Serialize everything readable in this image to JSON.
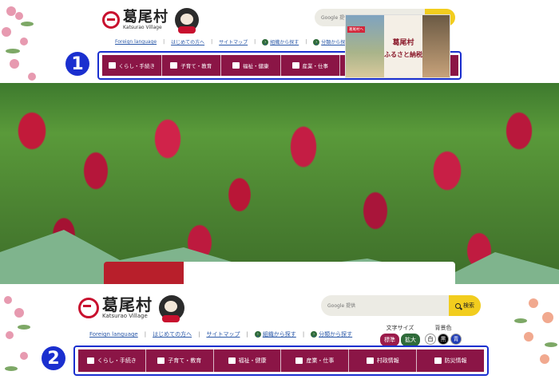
{
  "site": {
    "logo_text": "葛尾村",
    "logo_subtext": "Katsurao Village"
  },
  "search": {
    "placeholder": "Google 提供",
    "button_label": "検索"
  },
  "utility_links": {
    "foreign_language": "Foreign language",
    "first_time": "はじめての方へ",
    "sitemap": "サイトマップ",
    "by_organization": "組織から探す",
    "by_category": "分類から探す"
  },
  "text_size": {
    "label": "文字サイズ",
    "standard": "標準",
    "large": "拡大"
  },
  "background_color": {
    "label": "背景色",
    "white": "白",
    "black": "黒",
    "blue": "青"
  },
  "nav": {
    "items": [
      {
        "label": "くらし・手続き",
        "icon": "house-icon"
      },
      {
        "label": "子育て・教育",
        "icon": "parent-child-icon"
      },
      {
        "label": "福祉・健康",
        "icon": "medical-cross-icon"
      },
      {
        "label": "産業・仕事",
        "icon": "briefcase-icon"
      },
      {
        "label": "村政情報",
        "icon": "document-icon"
      },
      {
        "label": "防災情報",
        "icon": "megaphone-icon"
      }
    ]
  },
  "banner": {
    "tag": "葛尾村へ",
    "title": "葛尾村",
    "subtitle": "ふるさと納税"
  },
  "annotations": {
    "step1": "1",
    "step2": "2"
  },
  "colors": {
    "nav_bg": "#8b1546",
    "highlight": "#1a2fcf",
    "search_button": "#f2cd1e",
    "std_pill": "#9b1b4b",
    "large_pill": "#2f6b3a"
  }
}
